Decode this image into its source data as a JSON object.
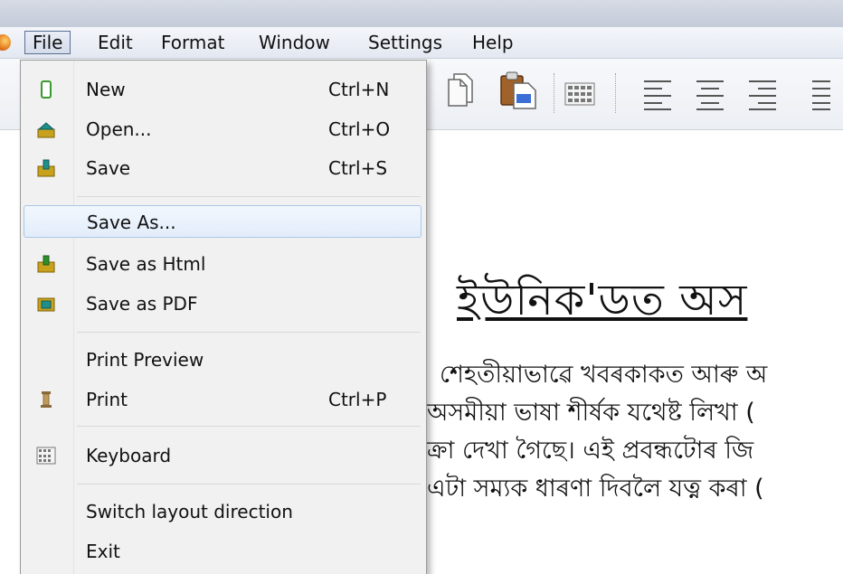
{
  "menubar": {
    "items": [
      "File",
      "Edit",
      "Format",
      "Window",
      "Settings",
      "Help"
    ],
    "active": "File"
  },
  "file_menu": {
    "items": [
      {
        "label": "New",
        "shortcut": "Ctrl+N",
        "icon": "new-document-icon"
      },
      {
        "label": "Open...",
        "shortcut": "Ctrl+O",
        "icon": "open-folder-icon"
      },
      {
        "label": "Save",
        "shortcut": "Ctrl+S",
        "icon": "save-icon"
      },
      {
        "label": "Save As...",
        "shortcut": "",
        "icon": "",
        "highlighted": true
      },
      {
        "label": "Save as Html",
        "shortcut": "",
        "icon": "save-html-icon"
      },
      {
        "label": "Save as PDF",
        "shortcut": "",
        "icon": "save-pdf-icon"
      },
      {
        "label": "Print Preview",
        "shortcut": "",
        "icon": ""
      },
      {
        "label": "Print",
        "shortcut": "Ctrl+P",
        "icon": "print-icon"
      },
      {
        "label": "Keyboard",
        "shortcut": "",
        "icon": "keyboard-icon"
      },
      {
        "label": "Switch layout direction",
        "shortcut": "",
        "icon": ""
      },
      {
        "label": "Exit",
        "shortcut": "",
        "icon": ""
      }
    ]
  },
  "toolbar": {
    "icons": [
      "copy-icon",
      "paste-icon",
      "keyboard-icon",
      "align-left-icon",
      "align-center-icon",
      "align-right-icon",
      "align-justify-icon"
    ]
  },
  "document": {
    "heading": "ইউনিক'ডত অস",
    "lines": [
      "শেহতীয়াভাৱে খবৰকাকত আৰু অ",
      "অসমীয়া ভাষা শীৰ্ষক যথেষ্ট লিখা (",
      "ক্ৰা দেখা গৈছে। এই প্ৰবন্ধটোৰ জি",
      "এটা সম্যক ধাৰণা দিবলৈ যত্ন কৰা ("
    ]
  },
  "colors": {
    "menu_bg": "#f1f1f1",
    "highlight_border": "#a9c6ea",
    "menubar_active_border": "#5a6f94"
  }
}
